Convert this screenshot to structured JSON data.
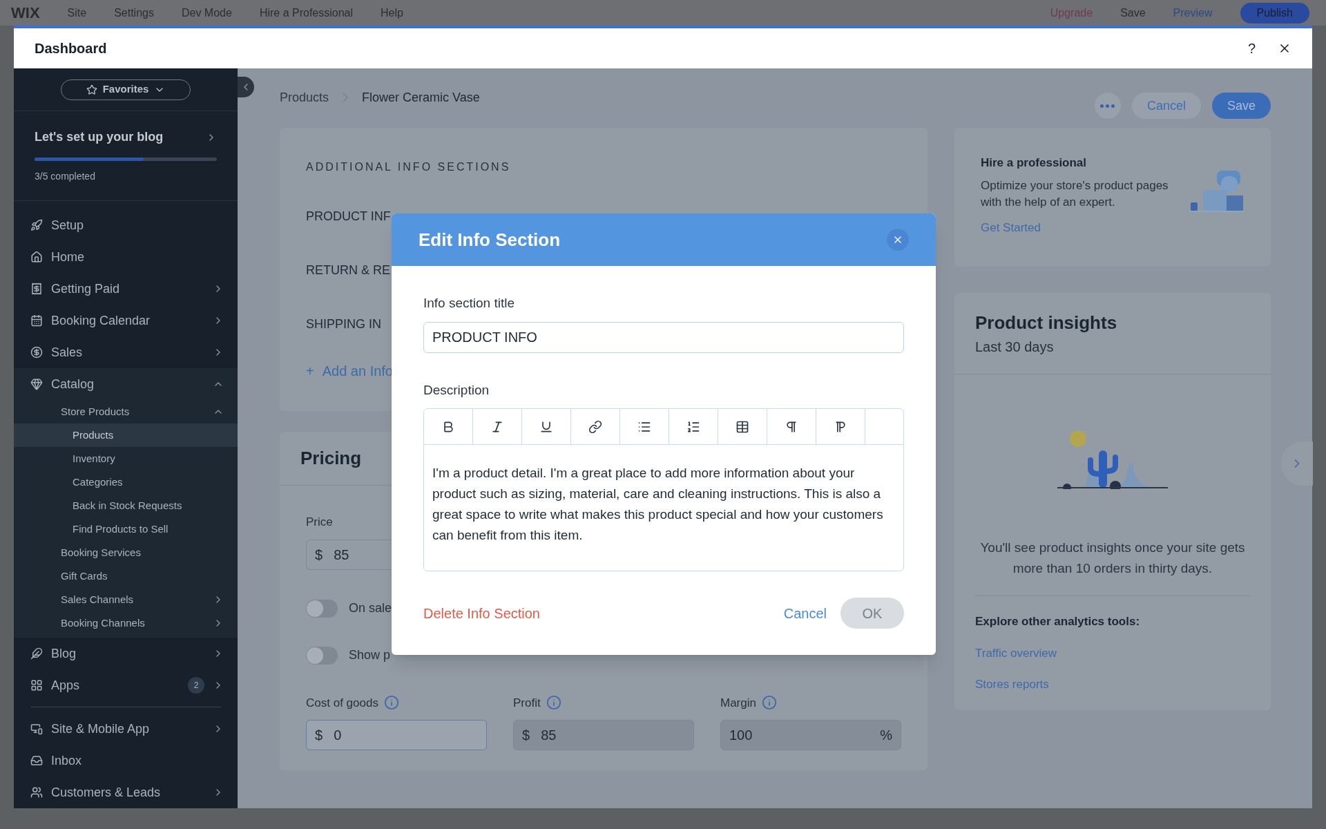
{
  "editor_bar": {
    "logo": "WIX",
    "menu": [
      "Site",
      "Settings",
      "Dev Mode",
      "Hire a Professional",
      "Help"
    ],
    "upgrade": "Upgrade",
    "save": "Save",
    "preview": "Preview",
    "publish": "Publish"
  },
  "dashboard": {
    "title": "Dashboard",
    "help": "?"
  },
  "sidebar": {
    "favorites": "Favorites",
    "setup": {
      "title": "Let's set up your blog",
      "level": 0.6,
      "status": "3/5 completed"
    },
    "items": [
      {
        "label": "Setup",
        "selected": false
      },
      {
        "label": "Home",
        "selected": false
      },
      {
        "label": "Getting Paid",
        "selected": false,
        "expanded": false
      },
      {
        "label": "Booking Calendar",
        "selected": false,
        "expanded": false
      },
      {
        "label": "Sales",
        "selected": false,
        "expanded": false
      },
      {
        "label": "Catalog",
        "selected": false,
        "expanded": true,
        "children": [
          {
            "label": "Store Products",
            "selected": false,
            "expanded": true,
            "children": [
              {
                "label": "Products",
                "selected": true
              },
              {
                "label": "Inventory",
                "selected": false
              },
              {
                "label": "Categories",
                "selected": false
              },
              {
                "label": "Back in Stock Requests",
                "selected": false
              },
              {
                "label": "Find Products to Sell",
                "selected": false
              }
            ]
          },
          {
            "label": "Booking Services",
            "selected": false
          },
          {
            "label": "Gift Cards",
            "selected": false
          },
          {
            "label": "Sales Channels",
            "selected": false,
            "expanded": false
          },
          {
            "label": "Booking Channels",
            "selected": false,
            "expanded": false
          }
        ]
      },
      {
        "label": "Blog",
        "selected": false,
        "expanded": false
      },
      {
        "label": "Apps",
        "selected": false,
        "expanded": false,
        "badge": "2"
      },
      {
        "label": "Site & Mobile App",
        "selected": false,
        "expanded": false,
        "divider_before": true
      },
      {
        "label": "Inbox",
        "selected": false
      },
      {
        "label": "Customers & Leads",
        "selected": false,
        "expanded": false
      }
    ]
  },
  "breadcrumbs": [
    "Products",
    "Flower Ceramic Vase"
  ],
  "actions": {
    "cancel": "Cancel",
    "save": "Save"
  },
  "info_sections": {
    "heading": "ADDITIONAL INFO SECTIONS",
    "rows": [
      "PRODUCT INF",
      "RETURN & RE",
      "SHIPPING IN"
    ],
    "add_icon": "+",
    "add": "Add an Info"
  },
  "pricing": {
    "title": "Pricing",
    "price_label": "Price",
    "price": {
      "currency": "$",
      "value": "85"
    },
    "toggles": [
      {
        "label": "On sale",
        "on": false
      },
      {
        "label": "Show p",
        "on": false
      }
    ],
    "fields": [
      {
        "label": "Cost of goods",
        "prefix": "$",
        "value": "0",
        "readonly": false
      },
      {
        "label": "Profit",
        "prefix": "$",
        "value": "85",
        "readonly": true
      },
      {
        "label": "Margin",
        "suffix": "%",
        "value": "100",
        "readonly": true
      }
    ]
  },
  "hire": {
    "title": "Hire a professional",
    "text": "Optimize your store's product pages with the help of an expert.",
    "link": "Get Started"
  },
  "insights": {
    "title": "Product insights",
    "subtitle": "Last 30 days",
    "message": "You'll see product insights once your site gets more than 10 orders in thirty days.",
    "explore": "Explore other analytics tools:",
    "links": [
      "Traffic overview",
      "Stores reports"
    ]
  },
  "modal": {
    "title": "Edit Info Section",
    "title_label": "Info section title",
    "title_value": "PRODUCT INFO",
    "description_label": "Description",
    "description": "I'm a product detail. I'm a great place to add more information about your product such as sizing, material, care and cleaning instructions. This is also a great space to write what makes this product special and how your customers can benefit from this item.",
    "delete": "Delete Info Section",
    "cancel": "Cancel",
    "ok": "OK",
    "ok_disabled": true
  }
}
